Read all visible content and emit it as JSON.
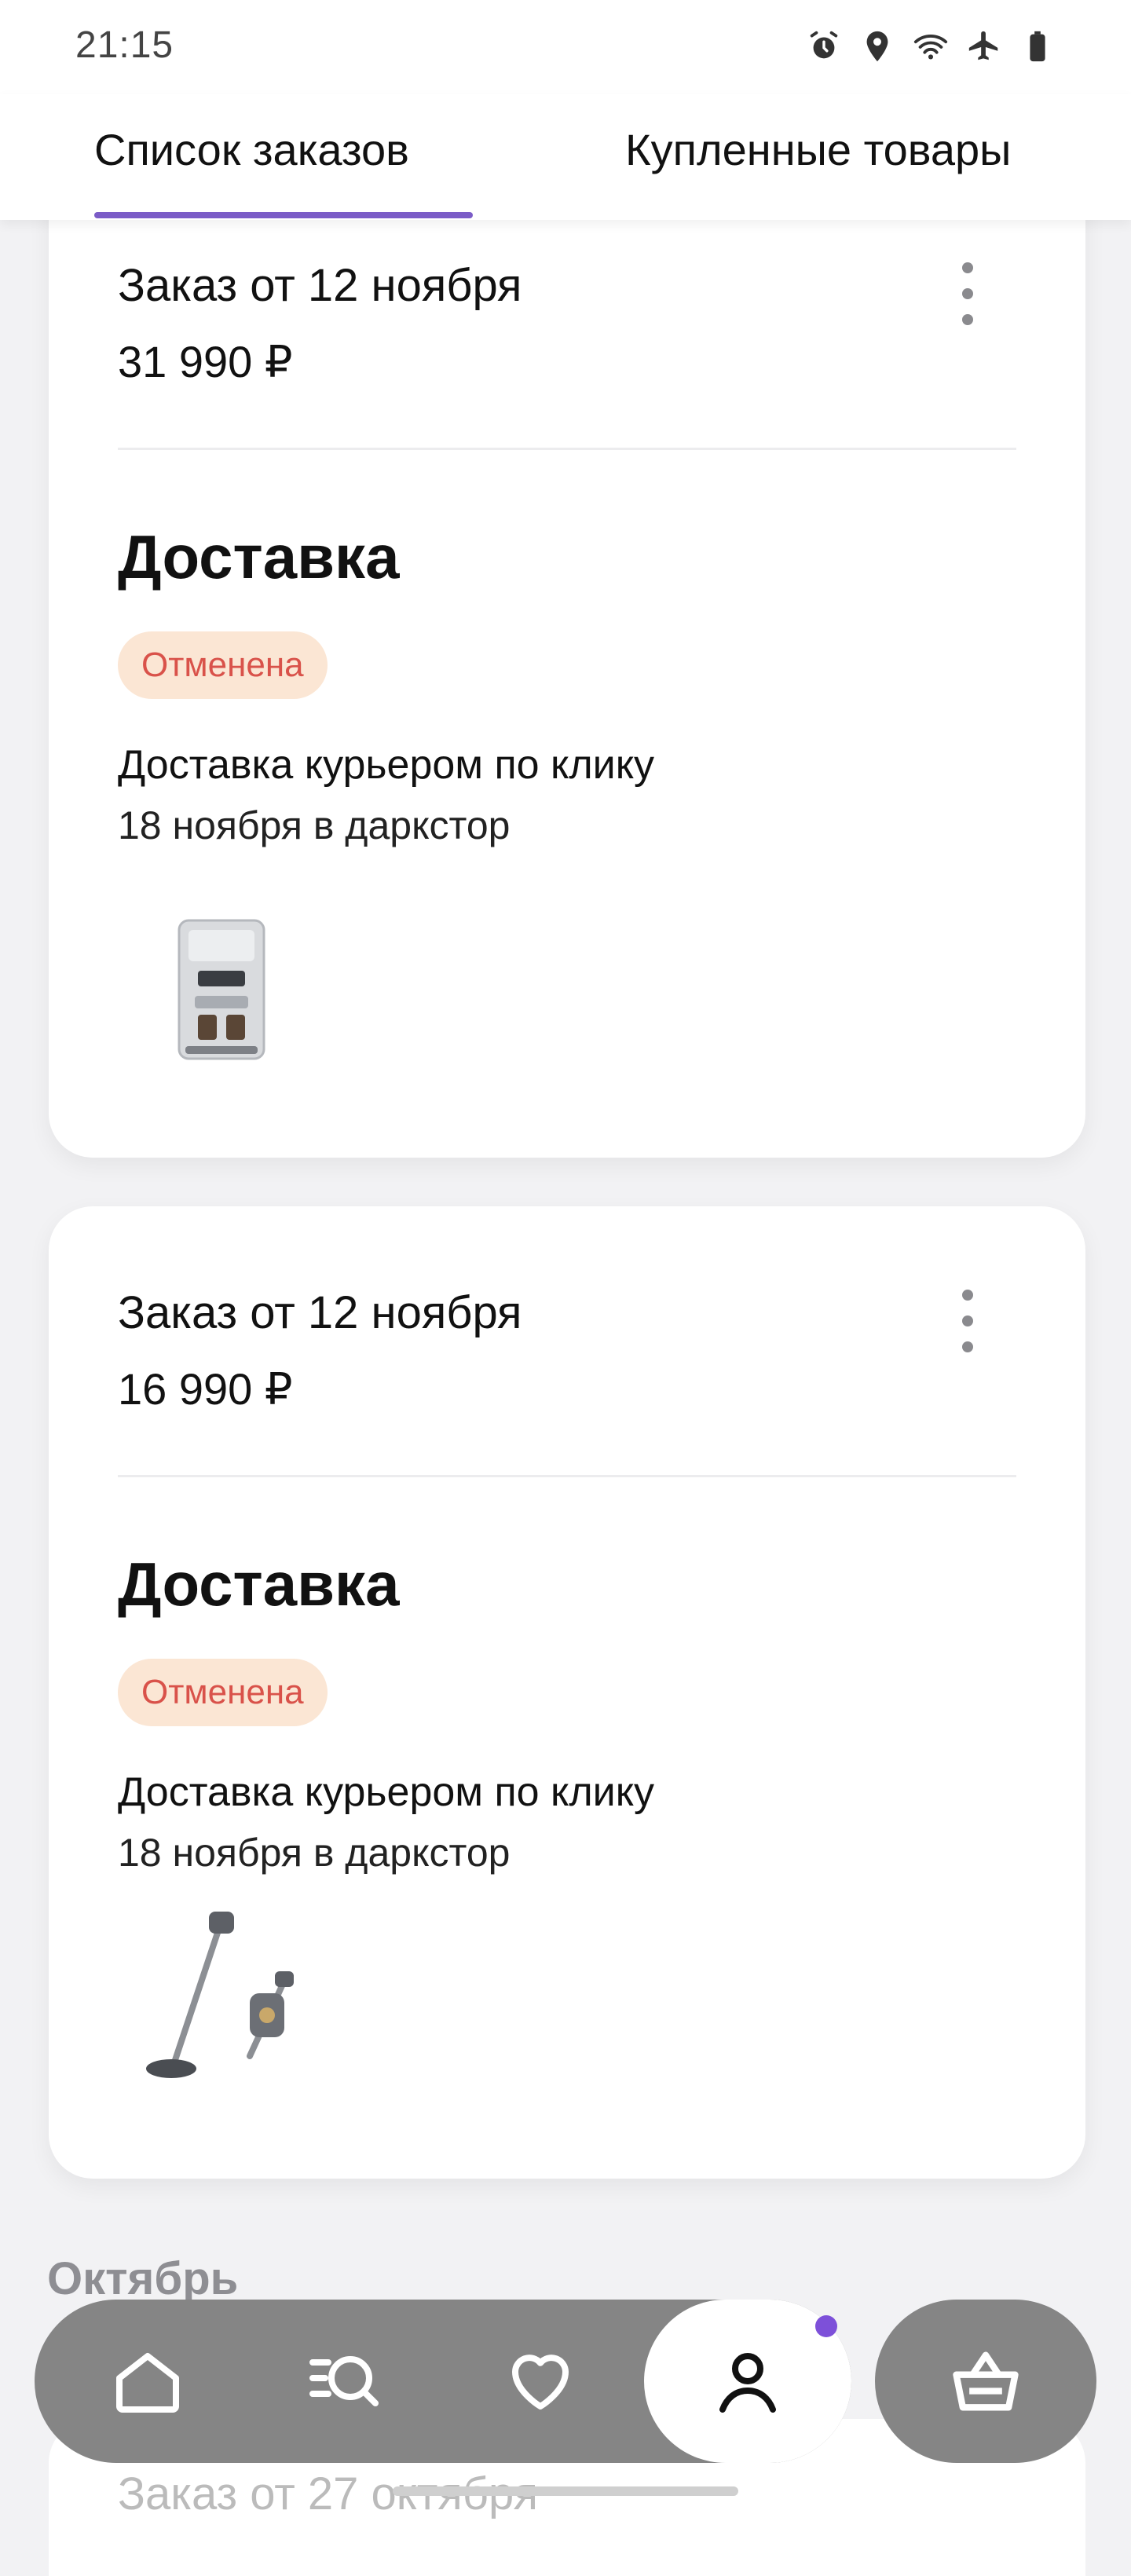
{
  "status_bar": {
    "time": "21:15",
    "icons": [
      "alarm-icon",
      "location-icon",
      "wifi-icon",
      "airplane-icon",
      "battery-icon"
    ]
  },
  "tabs": [
    {
      "label": "Список заказов",
      "active": true
    },
    {
      "label": "Купленные товары",
      "active": false
    }
  ],
  "orders": [
    {
      "title": "Заказ от 12 ноября",
      "price": "31 990 ₽",
      "delivery_heading": "Доставка",
      "status": "Отменена",
      "method": "Доставка курьером по клику",
      "date": "18 ноября в даркстор",
      "product_icon": "coffee-machine-icon"
    },
    {
      "title": "Заказ от 12 ноября",
      "price": "16 990 ₽",
      "delivery_heading": "Доставка",
      "status": "Отменена",
      "method": "Доставка курьером по клику",
      "date": "18 ноября в даркстор",
      "product_icon": "vacuum-cleaner-icon"
    }
  ],
  "month_label": "Октябрь",
  "next_order_title": "Заказ от 27 октября",
  "bottom_nav": {
    "items": [
      "home-icon",
      "catalog-search-icon",
      "heart-icon",
      "profile-icon"
    ],
    "active": "profile-icon",
    "cart": "basket-icon"
  },
  "colors": {
    "accent": "#7b5cc7",
    "status_badge_bg": "#fbe6d4",
    "status_badge_text": "#d9524a",
    "nav_bg": "#858585"
  }
}
